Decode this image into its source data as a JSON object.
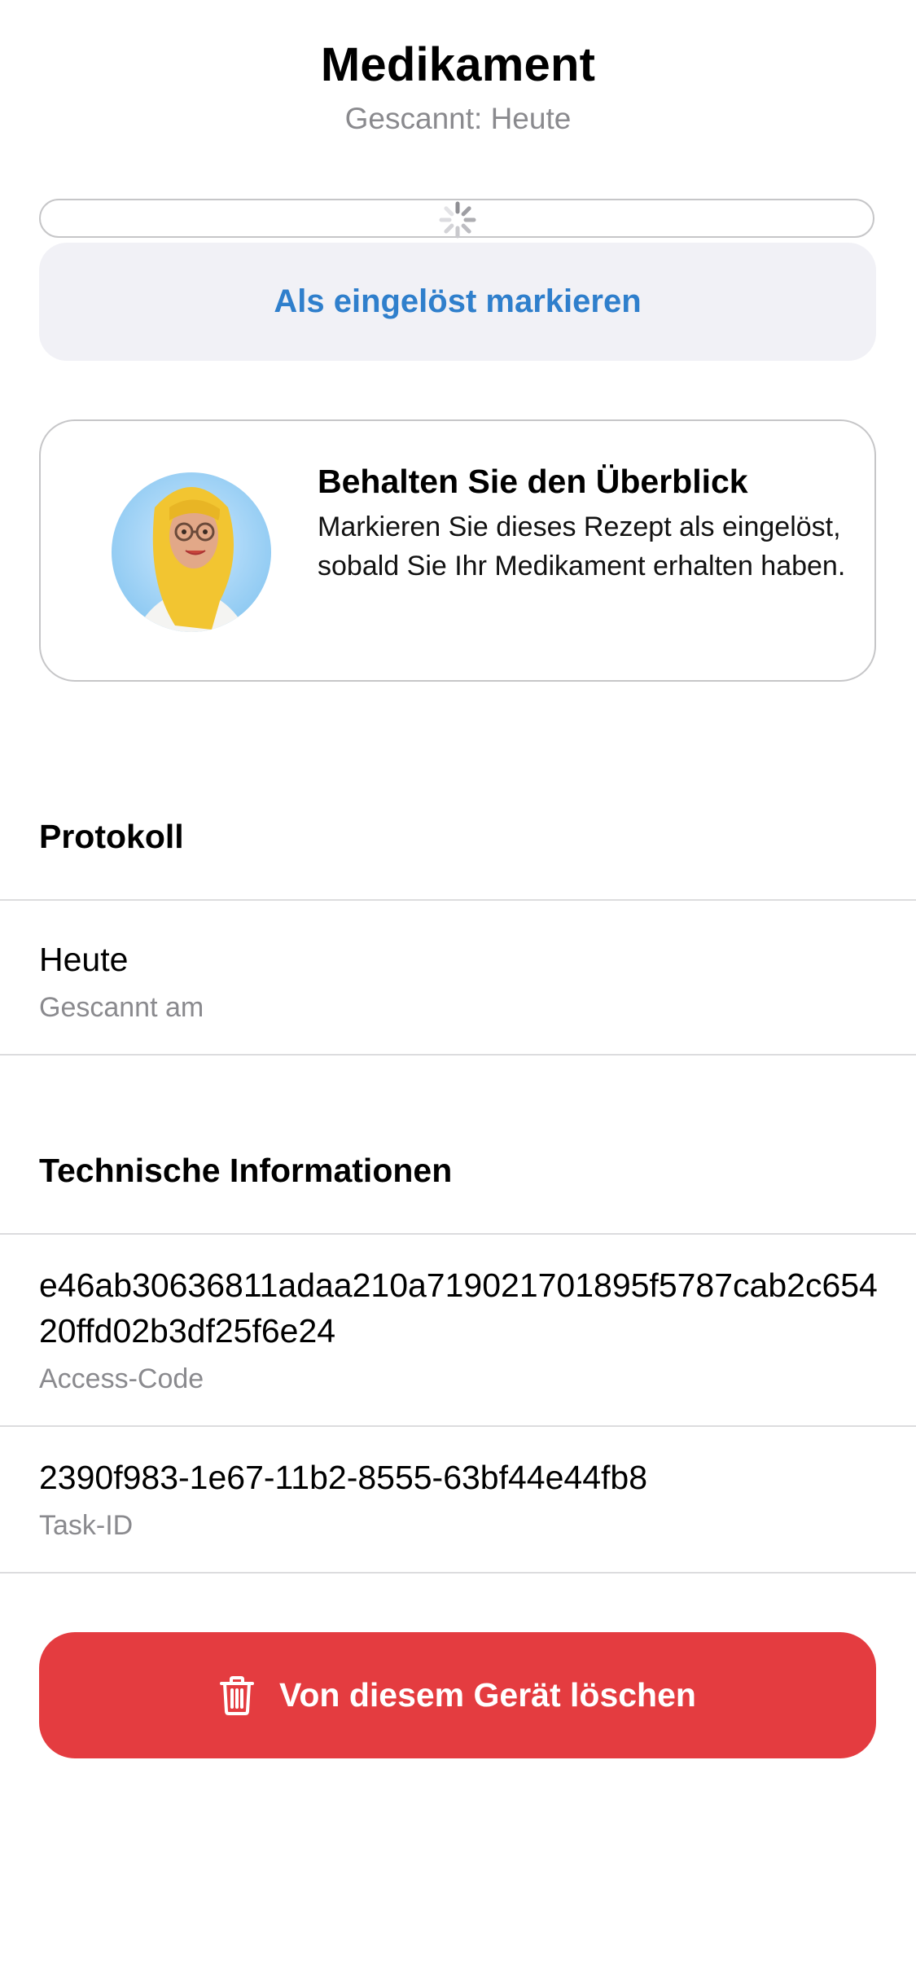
{
  "header": {
    "title": "Medikament",
    "subtitle": "Gescannt: Heute"
  },
  "progress": {
    "state": "loading"
  },
  "actions": {
    "mark_redeemed_label": "Als eingelöst markieren",
    "delete_label": "Von diesem Gerät löschen"
  },
  "info_card": {
    "heading": "Behalten Sie den Überblick",
    "body": "Markieren Sie dieses Rezept als eingelöst, sobald Sie Ihr Medikament erhalten haben."
  },
  "protocol": {
    "heading": "Protokoll",
    "items": [
      {
        "value": "Heute",
        "label": "Gescannt am"
      }
    ]
  },
  "technical": {
    "heading": "Technische Informationen",
    "items": [
      {
        "value": "e46ab30636811adaa210a719021701895f5787cab2c65420ffd02b3df25f6e24",
        "label": "Access-Code"
      },
      {
        "value": "2390f983-1e67-11b2-8555-63bf44e44fb8",
        "label": "Task-ID"
      }
    ]
  },
  "colors": {
    "accent_blue": "#2f7fcc",
    "danger_red": "#e43c40",
    "secondary_text": "#8a8a8e",
    "button_bg": "#f1f1f6"
  },
  "icons": {
    "spinner": "activity-spinner-icon",
    "trash": "trash-icon",
    "avatar": "avatar-illustration"
  }
}
